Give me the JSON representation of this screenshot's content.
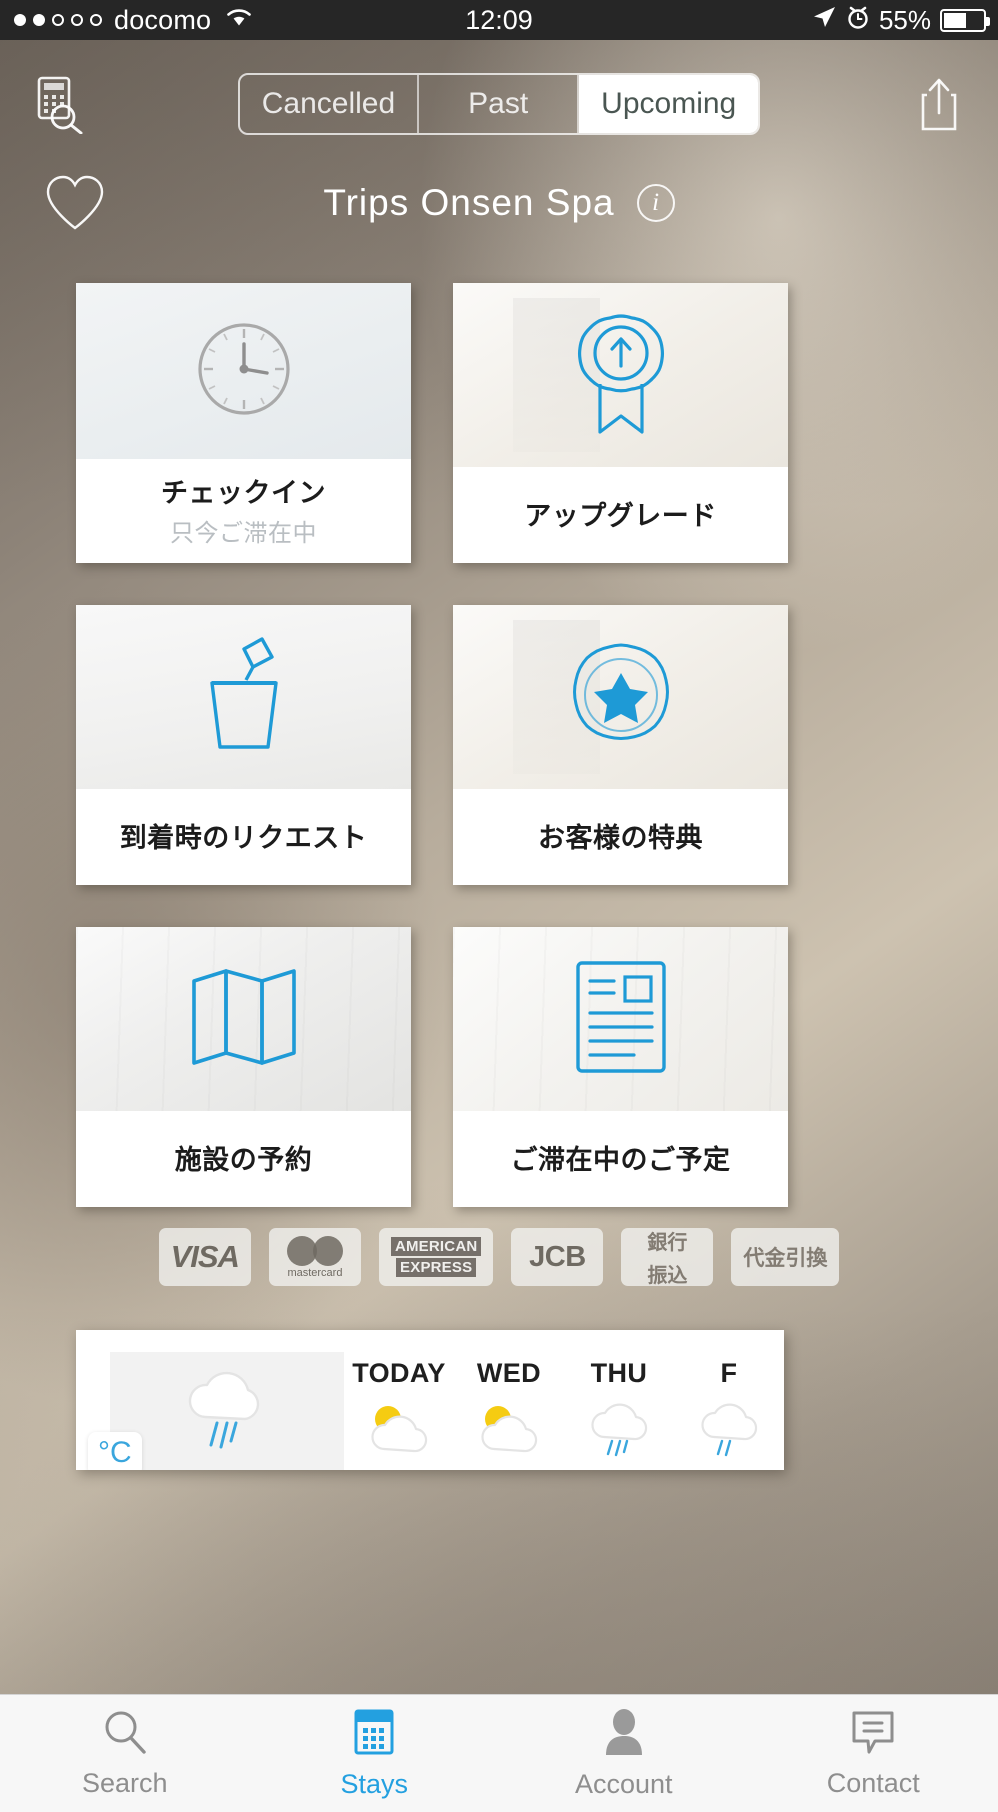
{
  "status_bar": {
    "signal_dots": [
      "on",
      "on",
      "off",
      "off",
      "off"
    ],
    "carrier": "docomo",
    "wifi_icon": "wifi-icon",
    "time": "12:09",
    "location_icon": "location-arrow-icon",
    "alarm_icon": "alarm-clock-icon",
    "battery_percent": "55%"
  },
  "top_nav": {
    "left_icon": "calculator-search-icon",
    "right_icon": "share-icon",
    "segments": [
      {
        "label": "Cancelled",
        "active": false
      },
      {
        "label": "Past",
        "active": false
      },
      {
        "label": "Upcoming",
        "active": true
      }
    ]
  },
  "title_row": {
    "favorite_icon": "heart-outline-icon",
    "title": "Trips Onsen Spa",
    "info_icon": "info-icon",
    "info_glyph": "i"
  },
  "cards": [
    {
      "id": "check-in",
      "icon": "clock-icon",
      "title": "チェックイン",
      "subtitle": "只今ご滞在中",
      "icon_color": "#a6a6a6",
      "enabled": false
    },
    {
      "id": "upgrade",
      "icon": "ribbon-award-icon",
      "title": "アップグレード",
      "subtitle": "",
      "icon_color": "#1e9ad6",
      "enabled": true
    },
    {
      "id": "arrival-request",
      "icon": "champagne-bucket-icon",
      "title": "到着時のリクエスト",
      "subtitle": "",
      "icon_color": "#1e9ad6",
      "enabled": true
    },
    {
      "id": "guest-benefits",
      "icon": "star-badge-icon",
      "title": "お客様の特典",
      "subtitle": "",
      "icon_color": "#1e9ad6",
      "enabled": true
    },
    {
      "id": "facility-booking",
      "icon": "map-folded-icon",
      "title": "施設の予約",
      "subtitle": "",
      "icon_color": "#1e9ad6",
      "enabled": true
    },
    {
      "id": "stay-schedule",
      "icon": "document-icon",
      "title": "ご滞在中のご予定",
      "subtitle": "",
      "icon_color": "#1e9ad6",
      "enabled": true
    }
  ],
  "payment_methods": [
    {
      "id": "visa",
      "text": "VISA"
    },
    {
      "id": "mastercard",
      "text": "mastercard"
    },
    {
      "id": "amex",
      "line1": "AMERICAN",
      "line2": "EXPRESS"
    },
    {
      "id": "jcb",
      "text": "JCB"
    },
    {
      "id": "bank-transfer",
      "line1": "銀行",
      "line2": "振込"
    },
    {
      "id": "cash-on-delivery",
      "text": "代金引換"
    }
  ],
  "weather": {
    "unit": "°C",
    "current_icon": "rain-cloud-icon",
    "days": [
      {
        "name": "TODAY",
        "icon": "sun-cloud-icon"
      },
      {
        "name": "WED",
        "icon": "sun-cloud-icon"
      },
      {
        "name": "THU",
        "icon": "rain-cloud-icon"
      },
      {
        "name": "F",
        "icon": "rain-cloud-icon"
      }
    ]
  },
  "tab_bar": [
    {
      "id": "search",
      "label": "Search",
      "icon": "magnifier-icon",
      "active": false
    },
    {
      "id": "stays",
      "label": "Stays",
      "icon": "calendar-icon",
      "active": true
    },
    {
      "id": "account",
      "label": "Account",
      "icon": "person-icon",
      "active": false
    },
    {
      "id": "contact",
      "label": "Contact",
      "icon": "chat-bubble-icon",
      "active": false
    }
  ],
  "colors": {
    "accent": "#1e9ad6",
    "tab_active": "#23a0e0",
    "disabled_icon": "#a6a6a6",
    "card_subtitle": "#b9bec2",
    "status_bar_bg": "#262626"
  }
}
